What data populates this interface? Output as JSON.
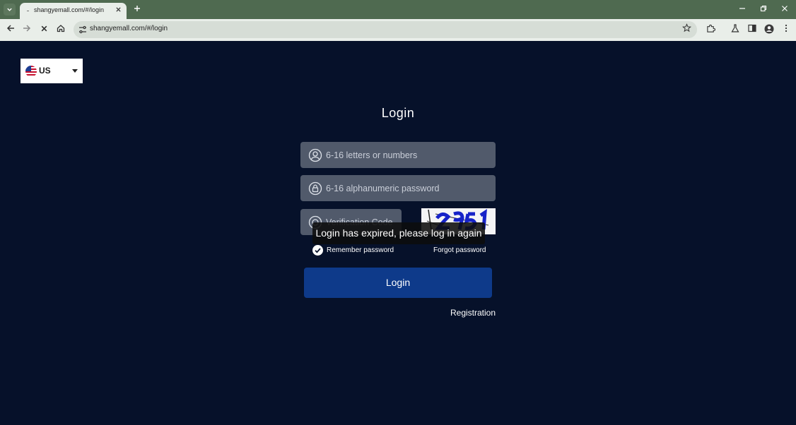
{
  "browser": {
    "tab_title": "shangyemall.com/#/login",
    "url": "shangyemall.com/#/login",
    "icons": {
      "tab_list": "chevron-down-icon",
      "tab_close": "close-icon",
      "new_tab": "plus-icon",
      "back": "arrow-left-icon",
      "forward": "arrow-right-icon",
      "stop": "close-icon",
      "home": "home-icon",
      "site_info": "tune-icon",
      "bookmark": "star-icon",
      "extensions": "puzzle-icon",
      "labs": "flask-icon",
      "side_panel": "side-panel-icon",
      "profile": "avatar-icon",
      "menu": "kebab-icon"
    }
  },
  "language": {
    "selected": "US",
    "flag": "us-flag-icon"
  },
  "login": {
    "title": "Login",
    "username_placeholder": "6-16 letters or numbers",
    "password_placeholder": "6-16 alphanumeric password",
    "code_placeholder": "Verification Code",
    "remember_label": "Remember password",
    "forgot_label": "Forgot password",
    "submit_label": "Login",
    "register_label": "Registration"
  },
  "toast": {
    "message": "Login has expired, please log in again"
  },
  "colors": {
    "page_bg": "#06112a",
    "input_bg": "#515a6b",
    "button_bg": "#0e3a8a",
    "chrome_tabbar": "#4f6a50",
    "chrome_toolbar": "#e9eee9"
  }
}
